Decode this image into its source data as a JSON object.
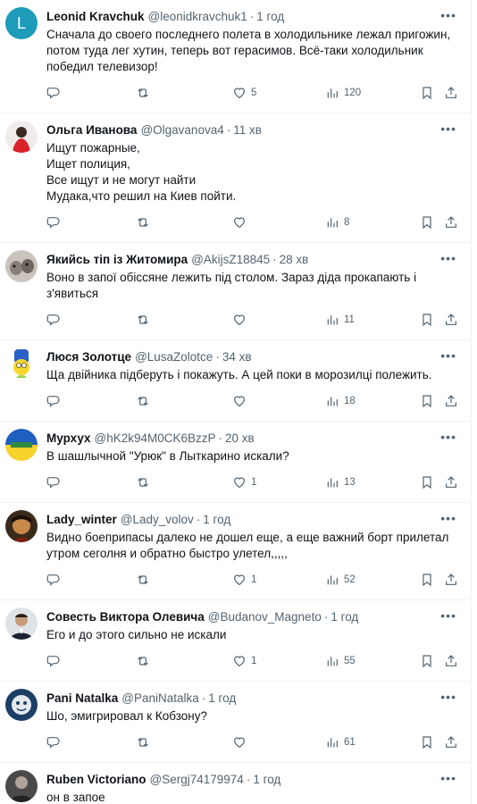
{
  "tweets": [
    {
      "avatar_letter": "L",
      "name": "Leonid Kravchuk",
      "handle": "@leonidkravchuk1",
      "time": "1 год",
      "text": "Сначала до своего последнего полета в холодильнике лежал пригожин,\nпотом туда лег хутин, теперь вот герасимов. Всё-таки холодильник\nпобедил телевизор!",
      "likes": "5",
      "views": "120"
    },
    {
      "name": "Ольга Иванова",
      "handle": "@Olgavanova4",
      "time": "11 хв",
      "text": "Ищут пожарные,\nИщет полиция,\nВсе ищут и не могут найти\nМудака,что решил на Киев пойти.",
      "likes": "",
      "views": "8"
    },
    {
      "name": "Якийсь тіп із Житомира",
      "handle": "@AkijsZ18845",
      "time": "28 хв",
      "text": "Воно в запої обіссяне лежить під столом. Зараз діда прокапають і\nз'явиться",
      "likes": "",
      "views": "11"
    },
    {
      "name": "Люся Золотце",
      "handle": "@LusaZolotce",
      "time": "34 хв",
      "text": "Ща двійника підберуть і покажуть.  А цей поки в морозилці полежить.",
      "likes": "",
      "views": "18"
    },
    {
      "name": "Мурхух",
      "handle": "@hK2k94M0CK6BzzP",
      "time": "20 хв",
      "text": "В шашлычной \"Урюк\" в Лыткарино искали?",
      "likes": "1",
      "views": "13"
    },
    {
      "name": "Lady_winter",
      "handle": "@Lady_volov",
      "time": "1 год",
      "text": "Видно боеприпасы далеко не дошел еще, а еще важний борт прилетал\nутром сеголня и обратно быстро улетел,,,,,",
      "likes": "1",
      "views": "52"
    },
    {
      "name": "Совесть Виктора Олевича",
      "handle": "@Budanov_Magneto",
      "time": "1 год",
      "text": "Его и до этого сильно не искали",
      "likes": "1",
      "views": "55"
    },
    {
      "name": "Pani Natalka",
      "handle": "@PaniNatalka",
      "time": "1 год",
      "text": "Шо, эмигрировал к Кобзону?",
      "likes": "",
      "views": "61"
    },
    {
      "name": "Ruben Victoriano",
      "handle": "@Sergj74179974",
      "time": "1 год",
      "text": "он в запое",
      "likes": "",
      "views": ""
    }
  ]
}
